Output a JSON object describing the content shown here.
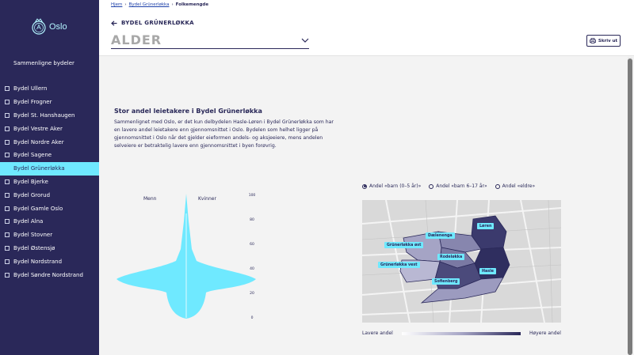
{
  "logo": {
    "text": "Oslo",
    "icon": "oslo-seal-icon"
  },
  "sidebar": {
    "compare_label": "Sammenligne bydeler",
    "items": [
      {
        "label": "Bydel Ullern",
        "active": false
      },
      {
        "label": "Bydel Frogner",
        "active": false
      },
      {
        "label": "Bydel St. Hanshaugen",
        "active": false
      },
      {
        "label": "Bydel Vestre Aker",
        "active": false
      },
      {
        "label": "Bydel Nordre Aker",
        "active": false
      },
      {
        "label": "Bydel Sagene",
        "active": false
      },
      {
        "label": "Bydel Grünerløkka",
        "active": true
      },
      {
        "label": "Bydel Bjerke",
        "active": false
      },
      {
        "label": "Bydel Grorud",
        "active": false
      },
      {
        "label": "Bydel Gamle Oslo",
        "active": false
      },
      {
        "label": "Bydel Alna",
        "active": false
      },
      {
        "label": "Bydel Stovner",
        "active": false
      },
      {
        "label": "Bydel Østensjø",
        "active": false
      },
      {
        "label": "Bydel Nordstrand",
        "active": false
      },
      {
        "label": "Bydel Søndre Nordstrand",
        "active": false
      }
    ]
  },
  "header": {
    "breadcrumbs": [
      "Hjem",
      "Bydel Grünerløkka",
      "Folkemengde"
    ],
    "back_label": "BYDEL GRÜNERLØKKA",
    "topic_value": "ALDER",
    "print_label": "Skriv ut"
  },
  "article": {
    "title": "Stor andel leietakere i Bydel Grünerløkka",
    "text": "Sammenlignet med Oslo, er det kun delbydelen Hasle-Løren i Bydel Grünerløkka som har en lavere andel leietakere enn gjennomsnittet i Oslo. Bydelen som helhet ligger på gjennomsnittet i Oslo når det gjelder eieformen andels- og aksjeeiere, mens andelen selveiere er betraktelig lavere enn gjennomsnittet i byen forøvrig."
  },
  "pyramid": {
    "men_label": "Menn",
    "women_label": "Kvinner",
    "yticks": [
      "100",
      "80",
      "60",
      "40",
      "20",
      "0"
    ]
  },
  "map": {
    "options": [
      {
        "label": "Andel «barn (0–5 år)»",
        "checked": true
      },
      {
        "label": "Andel «barn 6–17 år»",
        "checked": false
      },
      {
        "label": "Andel «eldre»",
        "checked": false
      }
    ],
    "areas": [
      "Løren",
      "Dælenenga",
      "Grünerløkka øst",
      "Rodeløkka",
      "Grünerløkka vest",
      "Hasle",
      "Sofienberg"
    ],
    "legend_low": "Lavere andel",
    "legend_high": "Høyere andel",
    "colors": {
      "low": "#ffffff",
      "high": "#2a2859",
      "highlight": "#6fe9ff"
    }
  }
}
